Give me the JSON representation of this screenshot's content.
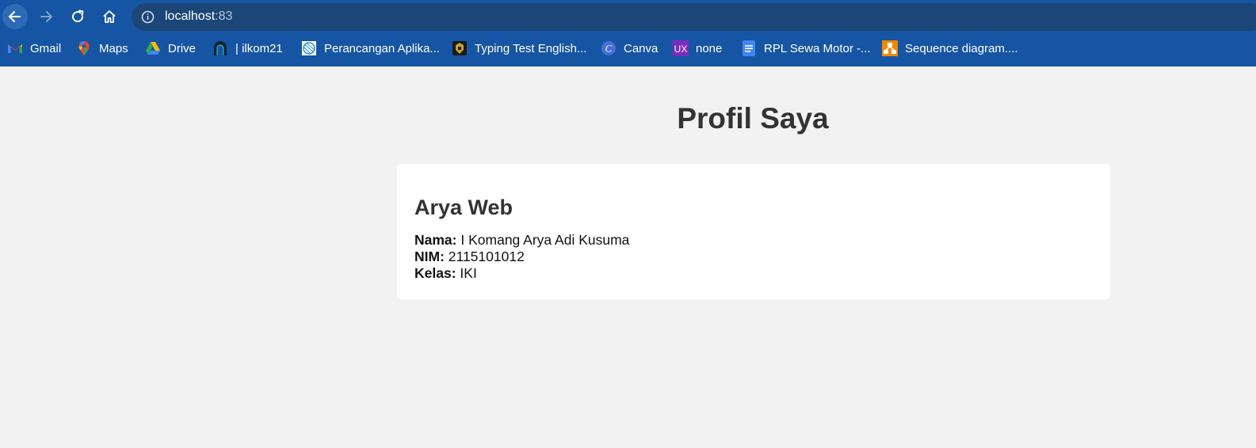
{
  "browser": {
    "url_host": "localhost",
    "url_port": ":83",
    "bookmarks": [
      {
        "label": "Gmail",
        "icon": "gmail-icon"
      },
      {
        "label": "Maps",
        "icon": "maps-icon"
      },
      {
        "label": "Drive",
        "icon": "drive-icon"
      },
      {
        "label": "| ilkom21",
        "icon": "arch-icon"
      },
      {
        "label": "Perancangan Aplika...",
        "icon": "globe-doc-icon"
      },
      {
        "label": "Typing Test English...",
        "icon": "keyboard-icon"
      },
      {
        "label": "Canva",
        "icon": "canva-icon"
      },
      {
        "label": "none",
        "icon": "ux-icon"
      },
      {
        "label": "RPL Sewa Motor -...",
        "icon": "docs-icon"
      },
      {
        "label": "Sequence diagram....",
        "icon": "diagram-icon"
      }
    ],
    "colors": {
      "frame": "#1655a3",
      "omnibox": "#1c4677",
      "page_bg": "#f2f2f2"
    }
  },
  "page": {
    "title": "Profil Saya",
    "card": {
      "heading": "Arya Web",
      "fields": [
        {
          "label": "Nama:",
          "value": "I Komang Arya Adi Kusuma"
        },
        {
          "label": "NIM:",
          "value": "2115101012"
        },
        {
          "label": "Kelas:",
          "value": "IKI"
        }
      ]
    }
  }
}
